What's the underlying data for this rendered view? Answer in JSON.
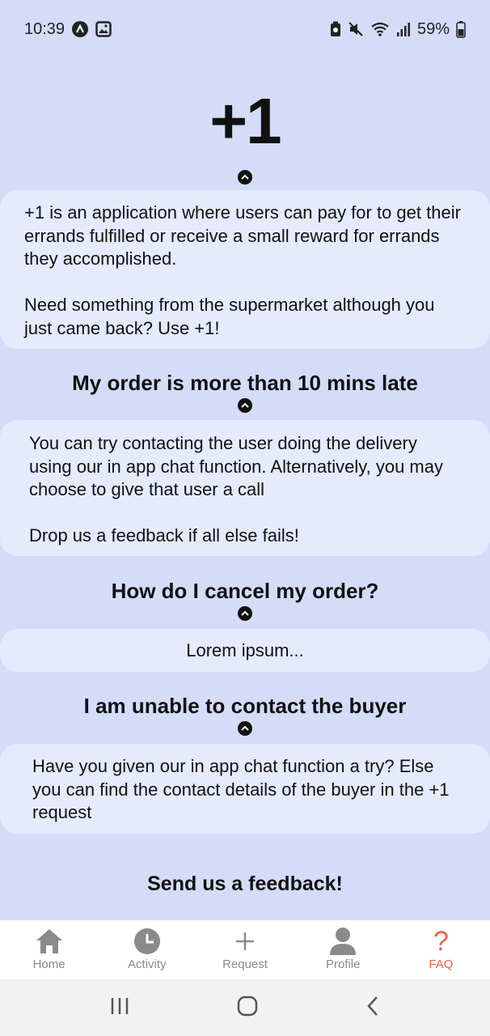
{
  "status_bar": {
    "time": "10:39",
    "battery": "59%"
  },
  "app": {
    "title": "+1"
  },
  "faq": {
    "intro": {
      "paragraph1": "+1 is an application where users can pay for to get their errands fulfilled or receive a small reward for errands they accomplished.",
      "paragraph2": "Need something from the supermarket although you just came back? Use +1!"
    },
    "items": [
      {
        "question": "My order is more than 10 mins late",
        "paragraph1": "You can try contacting the user doing the delivery using our in app chat function. Alternatively, you may choose to give that user a call",
        "paragraph2": "Drop us a feedback if all else fails!"
      },
      {
        "question": "How do I cancel my order?",
        "paragraph1": "Lorem ipsum..."
      },
      {
        "question": "I am unable to contact the buyer",
        "paragraph1": "Have you given our in app chat function a try? Else you can find the contact details of the buyer in the +1 request"
      }
    ],
    "feedback_label": "Send us a feedback!"
  },
  "bottom_nav": {
    "items": [
      {
        "label": "Home",
        "icon": "home-icon"
      },
      {
        "label": "Activity",
        "icon": "clock-icon"
      },
      {
        "label": "Request",
        "icon": "plus-icon"
      },
      {
        "label": "Profile",
        "icon": "person-icon"
      },
      {
        "label": "FAQ",
        "icon": "question-icon"
      }
    ],
    "active_index": 4,
    "active_color": "#e8624a"
  }
}
